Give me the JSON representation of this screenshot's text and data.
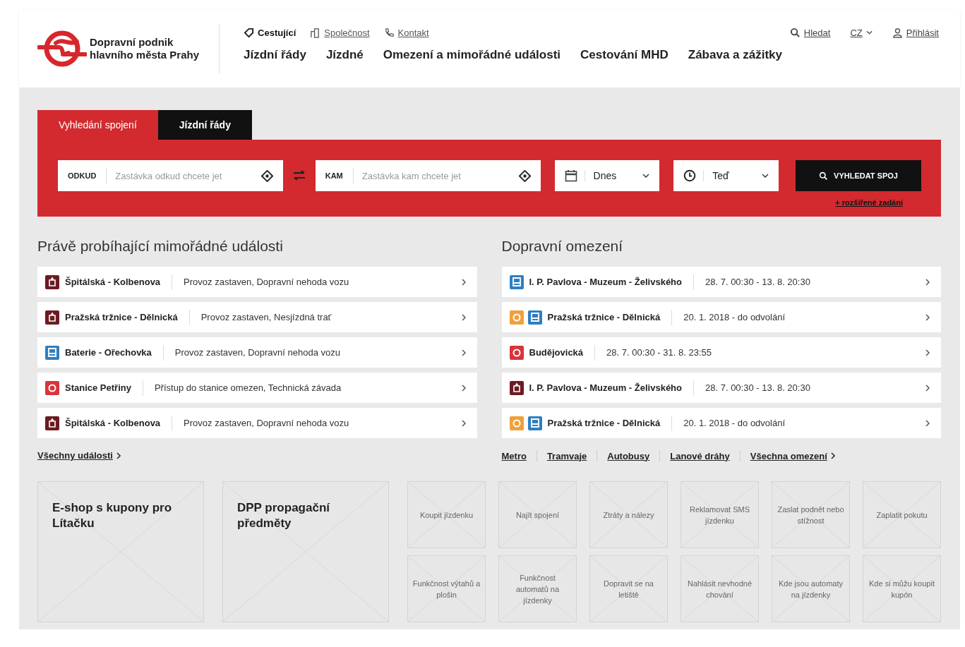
{
  "header": {
    "logo_text": [
      "Dopravní podnik",
      "hlavního města Prahy"
    ],
    "top_links": [
      {
        "label": "Cestující",
        "kind": "tag",
        "selected": true
      },
      {
        "label": "Společnost",
        "kind": "building",
        "selected": false
      },
      {
        "label": "Kontakt",
        "kind": "phone",
        "selected": false
      }
    ],
    "search_link": "Hledat",
    "language": "CZ",
    "login": "Přihlásit",
    "nav": [
      "Jízdní řády",
      "Jízdné",
      "Omezení a mimořádné události",
      "Cestování MHD",
      "Zábava a zážitky"
    ]
  },
  "search": {
    "tabs": [
      {
        "label": "Vyhledání spojení",
        "selected": true
      },
      {
        "label": "Jízdní řády",
        "selected": false
      }
    ],
    "from": {
      "label": "ODKUD",
      "placeholder": "Zastávka odkud chcete jet"
    },
    "to": {
      "label": "KAM",
      "placeholder": "Zastávka kam chcete jet"
    },
    "date": "Dnes",
    "time": "Teď",
    "button": "VYHLEDAT SPOJ",
    "advanced_link": "+ rozšířené zadání"
  },
  "incidents": {
    "title": "Právě probíhající mimořádné události",
    "rows": [
      {
        "modes": [
          {
            "kind": "metro"
          }
        ],
        "name": "Špitálská - Kolbenova",
        "detail": "Provoz zastaven, Dopravní nehoda vozu"
      },
      {
        "modes": [
          {
            "kind": "metro"
          }
        ],
        "name": "Pražská tržnice - Dělnická",
        "detail": "Provoz zastaven, Nesjízdná trať"
      },
      {
        "modes": [
          {
            "kind": "bus"
          }
        ],
        "name": "Baterie - Ořechovka",
        "detail": "Provoz zastaven, Dopravní nehoda vozu"
      },
      {
        "modes": [
          {
            "kind": "tram"
          }
        ],
        "name": "Stanice Petřiny",
        "detail": "Přístup do stanice omezen, Technická závada"
      },
      {
        "modes": [
          {
            "kind": "metro"
          }
        ],
        "name": "Špitálská - Kolbenova",
        "detail": "Provoz zastaven, Dopravní nehoda vozu"
      }
    ],
    "link": "Všechny události"
  },
  "restrictions": {
    "title": "Dopravní omezení",
    "rows": [
      {
        "modes": [
          {
            "kind": "bus"
          }
        ],
        "name": "I. P. Pavlova - Muzeum - Želivského",
        "detail": "28. 7. 00:30 - 13. 8. 20:30"
      },
      {
        "modes": [
          {
            "kind": "train"
          },
          {
            "kind": "bus"
          }
        ],
        "name": "Pražská tržnice - Dělnická",
        "detail": "20. 1. 2018 - do odvolání"
      },
      {
        "modes": [
          {
            "kind": "tram"
          }
        ],
        "name": "Budějovická",
        "detail": "28. 7. 00:30 - 31. 8. 23:55"
      },
      {
        "modes": [
          {
            "kind": "metro"
          }
        ],
        "name": "I. P. Pavlova - Muzeum - Želivského",
        "detail": "28. 7. 00:30 - 13. 8. 20:30"
      },
      {
        "modes": [
          {
            "kind": "train"
          },
          {
            "kind": "bus"
          }
        ],
        "name": "Pražská tržnice - Dělnická",
        "detail": "20. 1. 2018 - do odvolání"
      }
    ],
    "filters": [
      "Metro",
      "Tramvaje",
      "Autobusy",
      "Lanové dráhy"
    ],
    "link": "Všechna omezení"
  },
  "promos": [
    "E-shop s kupony pro Lítačku",
    "DPP propagační předměty"
  ],
  "tiles": [
    "Koupit jízdenku",
    "Najít spojení",
    "Ztráty a nálezy",
    "Reklamovat SMS jízdenku",
    "Zaslat podnět nebo stížnost",
    "Zaplatit pokutu",
    "Funkčnost výtahů a plošin",
    "Funkčnost automatů na jízdenky",
    "Dopravit se na letiště",
    "Nahlásit nevhodné chování",
    "Kde jsou automaty na jízdenky",
    "Kde si můžu koupit kupón"
  ]
}
